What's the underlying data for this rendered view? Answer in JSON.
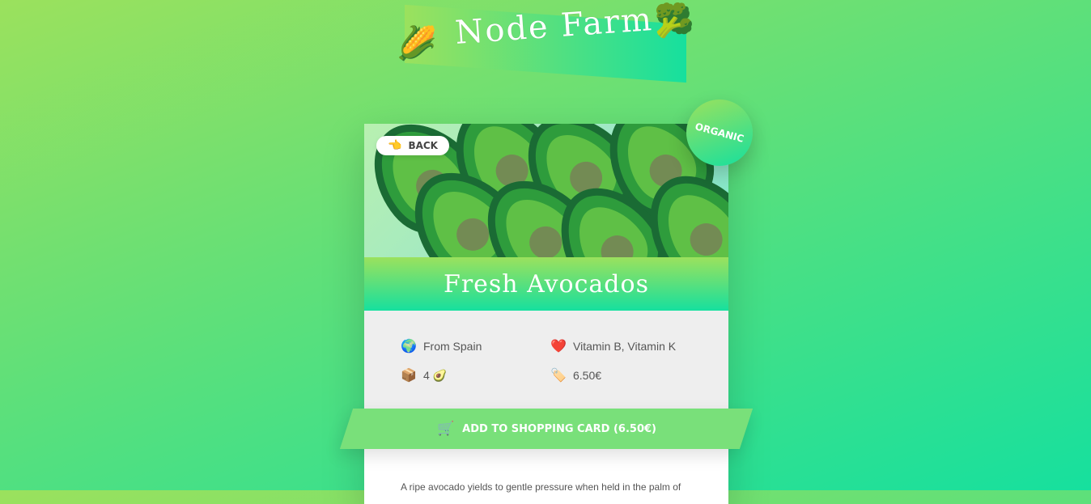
{
  "logo": {
    "title": "Node Farm",
    "left_icon": "🌽",
    "right_icon": "🥦"
  },
  "badge": {
    "label": "ORGANIC"
  },
  "card": {
    "back": {
      "icon": "👈",
      "label": "BACK"
    },
    "product_name": "Fresh Avocados",
    "details": {
      "origin": {
        "icon": "🌍",
        "text": "From Spain"
      },
      "nutrients": {
        "icon": "❤️",
        "text": "Vitamin B, Vitamin K"
      },
      "quantity": {
        "icon": "📦",
        "text": "4 🥑"
      },
      "price": {
        "icon": "🏷️",
        "text": "6.50€"
      }
    },
    "cart": {
      "icon": "🛒",
      "label": "ADD TO SHOPPING CARD (6.50€)"
    },
    "description": "A ripe avocado yields to gentle pressure when held in the palm of"
  },
  "colors": {
    "gradient_start": "#9be15d",
    "gradient_end": "#16e09e",
    "cart_button": "#79e07a",
    "detail_background": "#eeeeee"
  },
  "icons": {
    "hero_pattern": "avocado-pattern"
  }
}
